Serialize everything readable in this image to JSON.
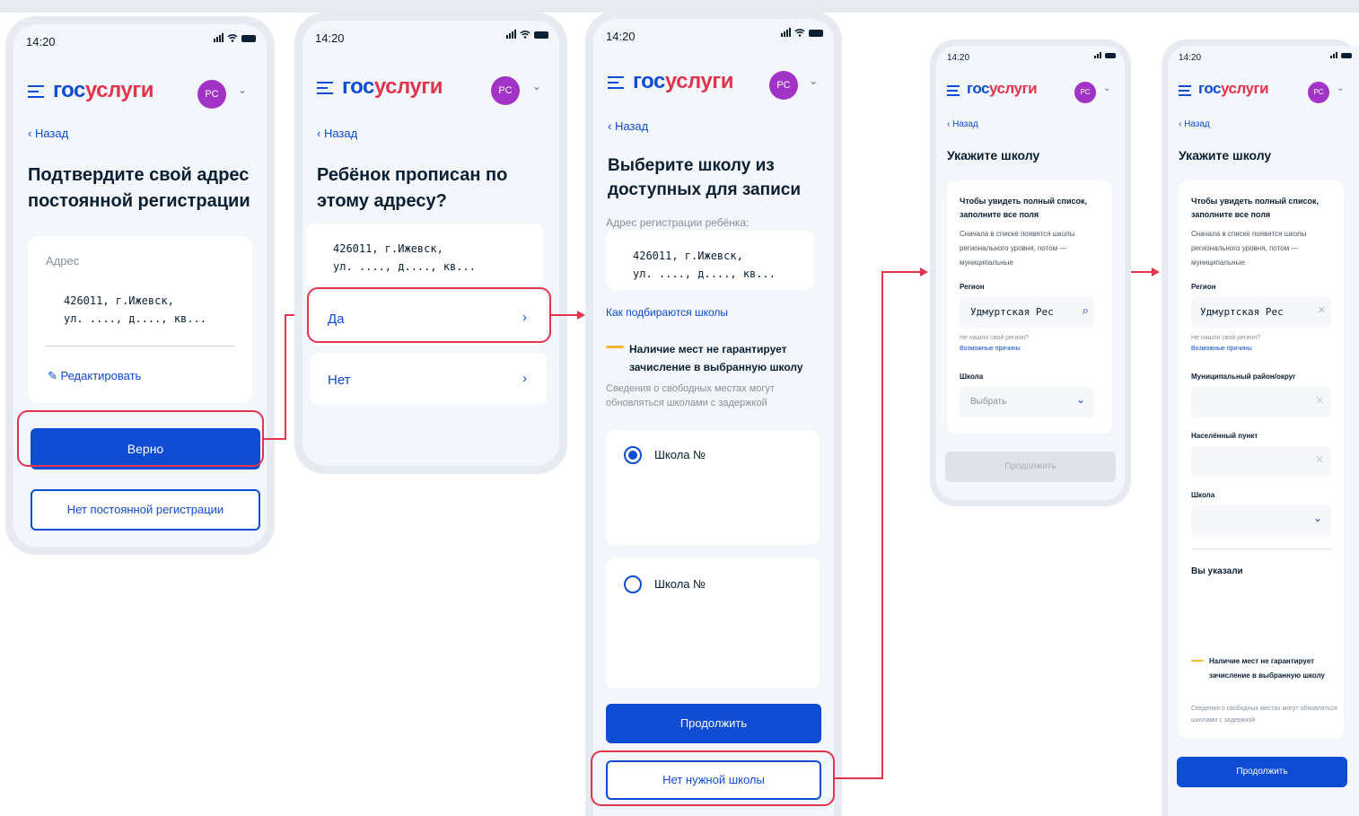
{
  "status": {
    "time": "14:20"
  },
  "header": {
    "logo_part1": "гос",
    "logo_part2": "услуги",
    "avatar": "РС"
  },
  "common": {
    "back": "Назад",
    "chevron": "⌄",
    "arrow": "›"
  },
  "screen1": {
    "title": "Подтвердите свой адрес постоянной регистрации",
    "address_label": "Адрес",
    "address_value": "426011, г.Ижевск,\nул. ...., д...., кв...",
    "edit": "Редактировать",
    "confirm": "Верно",
    "no_registration": "Нет постоянной регистрации"
  },
  "screen2": {
    "title": "Ребёнок прописан по этому адресу?",
    "address_value": "426011, г.Ижевск,\nул. ...., д...., кв...",
    "yes": "Да",
    "no": "Нет"
  },
  "screen3": {
    "title": "Выберите школу из доступных для записи",
    "address_label": "Адрес регистрации ребёнка:",
    "address_value": "426011, г.Ижевск,\nул. ...., д...., кв...",
    "how_link": "Как подбираются школы",
    "warning": "Наличие мест не гарантирует зачисление в выбранную школу",
    "note": "Сведения о свободных местах могут обновляться школами с задержкой",
    "school1": "Школа №",
    "school2": "Школа №",
    "continue": "Продолжить",
    "no_school": "Нет нужной школы"
  },
  "screen4": {
    "title": "Укажите школу",
    "info_bold": "Чтобы увидеть полный список, заполните все поля",
    "info": "Сначала в списке появятся школы регионального уровня, потом — муниципальные",
    "region_label": "Регион",
    "region_value": "Удмуртская Рес",
    "not_found": "Не нашли свой регион?",
    "reasons": "Возможные причины",
    "school_label": "Школа",
    "school_placeholder": "Выбрать",
    "continue": "Продолжить"
  },
  "screen5": {
    "title": "Укажите школу",
    "info_bold": "Чтобы увидеть полный список, заполните все поля",
    "info": "Сначала в списке появятся школы регионального уровня, потом — муниципальные",
    "region_label": "Регион",
    "region_value": "Удмуртская Рес",
    "not_found": "Не нашли свой регион?",
    "reasons": "Возможные причины",
    "district_label": "Муниципальный район/округ",
    "locality_label": "Населённый пункт",
    "school_label": "Школа",
    "you_specified": "Вы указали",
    "warning": "Наличие мест не гарантирует зачисление в выбранную школу",
    "note": "Сведения о свободных местах могут обновляться школами с задержкой",
    "continue": "Продолжить"
  },
  "colors": {
    "primary": "#0d4cd3",
    "accent": "#e3344e",
    "avatar": "#a233c7",
    "warning": "#f5b335"
  }
}
